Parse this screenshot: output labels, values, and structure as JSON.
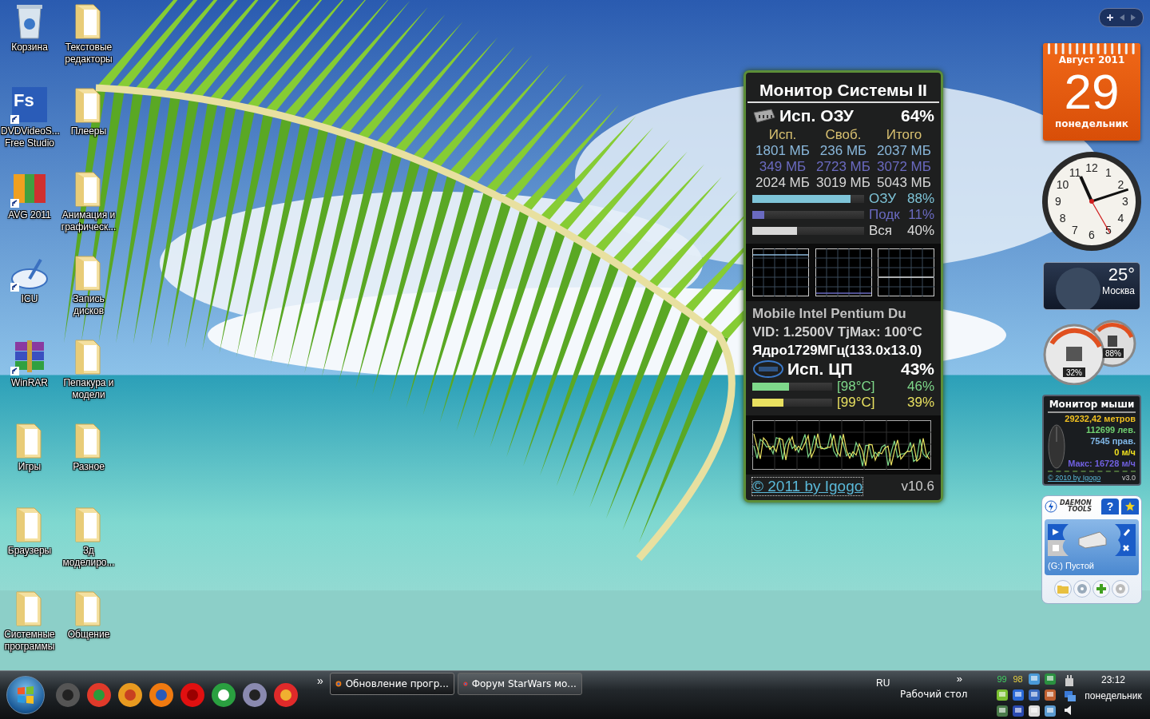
{
  "desktop_icons": [
    {
      "label": "Корзина",
      "kind": "trash",
      "shortcut": false
    },
    {
      "label": "DVDVideoS... Free Studio",
      "kind": "fs",
      "badge": "Fs",
      "shortcut": true
    },
    {
      "label": "AVG 2011",
      "kind": "avg",
      "shortcut": true
    },
    {
      "label": "ICU",
      "kind": "icu",
      "shortcut": true
    },
    {
      "label": "WinRAR",
      "kind": "winrar",
      "shortcut": true
    },
    {
      "label": "Игры",
      "kind": "folder",
      "shortcut": false
    },
    {
      "label": "Браузеры",
      "kind": "folder",
      "shortcut": false
    },
    {
      "label": "Системные программы",
      "kind": "folder",
      "shortcut": false
    },
    {
      "label": "Текстовые редакторы",
      "kind": "folder",
      "shortcut": false
    },
    {
      "label": "Плееры",
      "kind": "folder",
      "shortcut": false
    },
    {
      "label": "Анимация и графическ...",
      "kind": "folder",
      "shortcut": false
    },
    {
      "label": "Запись дисков",
      "kind": "folder",
      "shortcut": false
    },
    {
      "label": "Пепакура и модели",
      "kind": "folder",
      "shortcut": false
    },
    {
      "label": "Разное",
      "kind": "folder",
      "shortcut": false
    },
    {
      "label": "3д моделиро...",
      "kind": "folder",
      "shortcut": false
    },
    {
      "label": "Общение",
      "kind": "folder",
      "shortcut": false
    }
  ],
  "system_monitor": {
    "title": "Монитор Системы II",
    "memory": {
      "label": "Исп. ОЗУ",
      "percent": "64%"
    },
    "memory_table": {
      "columns": [
        "Исп.",
        "Своб.",
        "Итого"
      ],
      "rows": [
        {
          "cells": [
            "1801 МБ",
            "236 МБ",
            "2037 МБ"
          ],
          "color": "#8ab8dc"
        },
        {
          "cells": [
            "349 МБ",
            "2723 МБ",
            "3072 МБ"
          ],
          "color": "#6a6ac0"
        },
        {
          "cells": [
            "2024 МБ",
            "3019 МБ",
            "5043 МБ"
          ],
          "color": "#d8d8d8"
        }
      ]
    },
    "memory_bars": [
      {
        "label": "ОЗУ",
        "value": "88%",
        "level": 0.88,
        "color": "#7ec4d8"
      },
      {
        "label": "Подк",
        "value": "11%",
        "level": 0.11,
        "color": "#6a6ac0"
      },
      {
        "label": "Вся",
        "value": "40%",
        "level": 0.4,
        "color": "#d8d8d8"
      }
    ],
    "cpu_name": "Mobile Intel Pentium Du",
    "cpu_vid": "VID: 1.2500V TjMax: 100°C",
    "cpu_core": "Ядро1729МГц(133.0x13.0)",
    "cpu": {
      "label": "Исп. ЦП",
      "percent": "43%"
    },
    "cores": [
      {
        "temp": "[98°C]",
        "value": "46%",
        "level": 0.46,
        "color": "#7ed88a"
      },
      {
        "temp": "[99°C]",
        "value": "39%",
        "level": 0.39,
        "color": "#e8e060"
      }
    ],
    "link": "© 2011 by Igogo",
    "version": "v10.6"
  },
  "sidebar": {
    "calendar": {
      "month": "Август 2011",
      "day": "29",
      "weekday": "понедельник"
    },
    "clock": {
      "numerals": [
        "12",
        "11",
        "1",
        "10",
        "2",
        "9",
        "3",
        "8",
        "4",
        "7",
        "5",
        "6"
      ]
    },
    "weather": {
      "temperature": "25°",
      "city": "Москва"
    },
    "meters": {
      "cpu": "32%",
      "memory": "88%"
    },
    "mouse_monitor": {
      "title": "Монитор мыши",
      "distance": "29232,42 метров",
      "left": "112699 лев.",
      "right": "7545 прав.",
      "speed": "0 м/ч",
      "max": "Макс: 16728 м/ч",
      "link": "© 2010 by Igogo",
      "version": "v3.0"
    },
    "daemon_tools": {
      "brand_top": "DAEMON",
      "brand_bottom": "TOOLS",
      "help": "?",
      "drive": "(G:) Пустой"
    }
  },
  "taskbar": {
    "chevron": "»",
    "tasks": [
      {
        "label": "Обновление прогр...",
        "selected": true
      },
      {
        "label": "Форум StarWars мо...",
        "selected": false
      }
    ],
    "language": "RU",
    "toolbar_chevron": "»",
    "toolbar": "Рабочий стол",
    "tray_temps": [
      {
        "text": "99",
        "color": "#40d060"
      },
      {
        "text": "98",
        "color": "#e8d040"
      }
    ],
    "time": "23:12",
    "weekday": "понедельник"
  }
}
